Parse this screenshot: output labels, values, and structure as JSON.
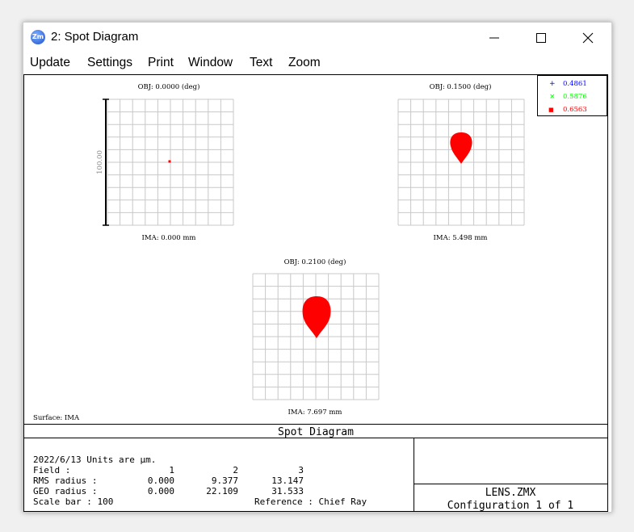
{
  "window": {
    "title": "2: Spot Diagram",
    "icon_name": "zemax-app-icon",
    "icon_text": "Zm",
    "controls": [
      "minimize-icon",
      "maximize-icon",
      "close-icon"
    ]
  },
  "menu": [
    "Update",
    "Settings",
    "Print",
    "Window",
    "Text",
    "Zoom"
  ],
  "plots": [
    {
      "obj_label": "OBJ: 0.0000 (deg)",
      "ima_label": "IMA: 0.000 mm",
      "spot": "dot"
    },
    {
      "obj_label": "OBJ: 0.1500 (deg)",
      "ima_label": "IMA: 5.498 mm",
      "spot": "drop-small"
    },
    {
      "obj_label": "OBJ: 0.2100 (deg)",
      "ima_label": "IMA: 7.697 mm",
      "spot": "drop-large"
    }
  ],
  "scale_label": "100.00",
  "legend": [
    {
      "value": "0.4861",
      "color": "#0000ff",
      "marker": "+"
    },
    {
      "value": "0.5876",
      "color": "#00ff00",
      "marker": "×"
    },
    {
      "value": "0.6563",
      "color": "#ff0000",
      "marker": "■"
    }
  ],
  "surface_label": "Surface: IMA",
  "panel": {
    "title": "Spot Diagram",
    "date_line": "2022/6/13  Units are µm.",
    "rows": [
      {
        "label": "Field      :",
        "v1": "1",
        "v2": "2",
        "v3": "3"
      },
      {
        "label": "RMS radius :",
        "v1": "0.000",
        "v2": "9.377",
        "v3": "13.147"
      },
      {
        "label": "GEO radius :",
        "v1": "0.000",
        "v2": "22.109",
        "v3": "31.533"
      }
    ],
    "scale_bar": "Scale bar  : 100",
    "reference": "Reference  : Chief Ray",
    "file": "LENS.ZMX",
    "config": "Configuration 1 of 1"
  },
  "colors": {
    "spot": "#ff0000",
    "grid": "#c8c8c8"
  }
}
